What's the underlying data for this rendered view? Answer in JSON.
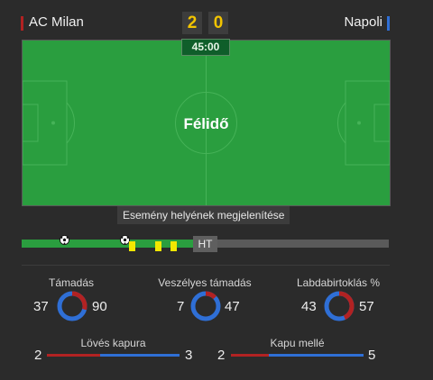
{
  "match": {
    "home_team": "AC Milan",
    "away_team": "Napoli",
    "home_score": "2",
    "away_score": "0",
    "clock": "45:00",
    "status_label": "Félidő",
    "home_color": "#b22222",
    "away_color": "#2f6fd6"
  },
  "timeline": {
    "tooltip": "Esemény helyének megjelenítése",
    "ht_label": "HT",
    "progress_fraction": 0.5,
    "events": [
      {
        "type": "goal",
        "icon": "soccer-ball-icon"
      },
      {
        "type": "goal",
        "icon": "soccer-ball-icon"
      },
      {
        "type": "yellow-card",
        "icon": "yellow-card-icon"
      },
      {
        "type": "yellow-card",
        "icon": "yellow-card-icon"
      },
      {
        "type": "yellow-card",
        "icon": "yellow-card-icon"
      }
    ]
  },
  "stats": {
    "attacks": {
      "label": "Támadás",
      "home": "37",
      "away": "90"
    },
    "dangerous_attacks": {
      "label": "Veszélyes támadás",
      "home": "7",
      "away": "47"
    },
    "possession": {
      "label": "Labdabirtoklás %",
      "home": "43",
      "away": "57"
    },
    "shots_on_target": {
      "label": "Lövés kapura",
      "home": "2",
      "away": "3"
    },
    "shots_off_target": {
      "label": "Kapu mellé",
      "home": "2",
      "away": "5"
    }
  }
}
